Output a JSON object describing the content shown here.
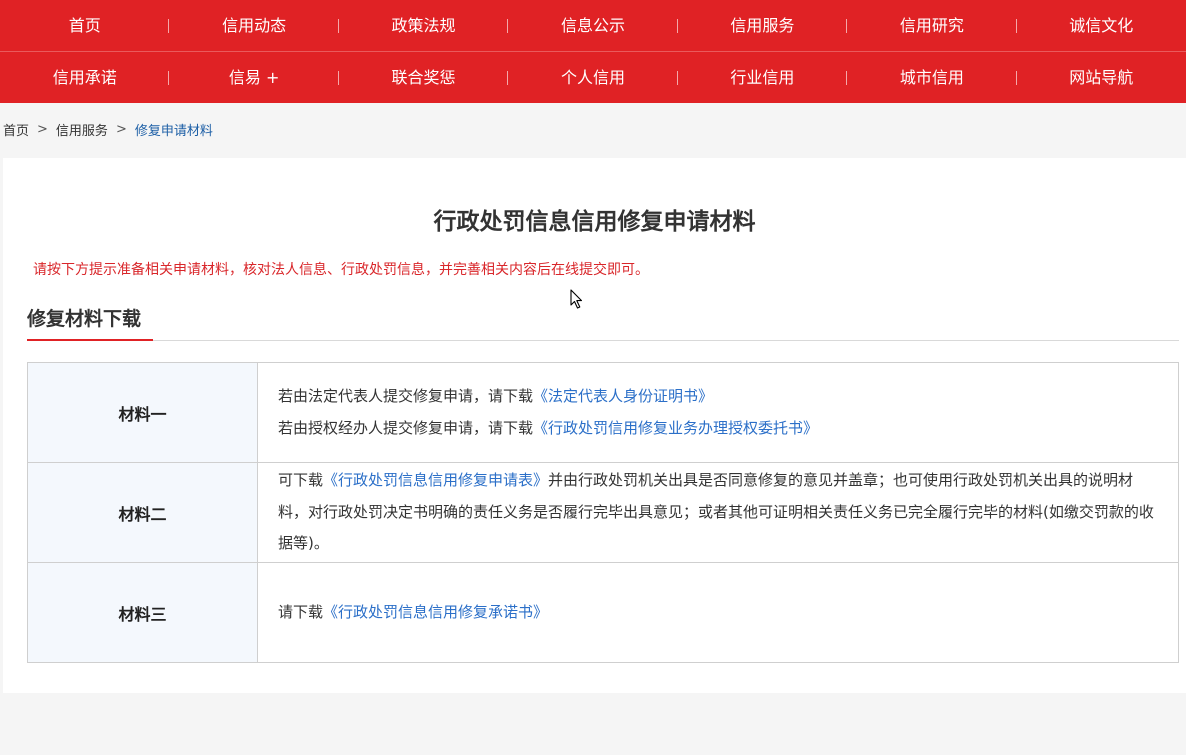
{
  "nav": {
    "row1": [
      "首页",
      "信用动态",
      "政策法规",
      "信息公示",
      "信用服务",
      "信用研究",
      "诚信文化"
    ],
    "row2": [
      "信用承诺",
      "信易 +",
      "联合奖惩",
      "个人信用",
      "行业信用",
      "城市信用",
      "网站导航"
    ]
  },
  "breadcrumb": {
    "home": "首页",
    "sep": ">",
    "level1": "信用服务",
    "current": "修复申请材料"
  },
  "page": {
    "title": "行政处罚信息信用修复申请材料",
    "notice": "请按下方提示准备相关申请材料，核对法人信息、行政处罚信息，并完善相关内容后在线提交即可。",
    "section_title": "修复材料下载"
  },
  "materials": [
    {
      "label": "材料一",
      "lines": [
        {
          "text": "若由法定代表人提交修复申请，请下载",
          "link": "《法定代表人身份证明书》"
        },
        {
          "text": "若由授权经办人提交修复申请，请下载",
          "link": "《行政处罚信用修复业务办理授权委托书》"
        }
      ]
    },
    {
      "label": "材料二",
      "pre": "可下载",
      "link": "《行政处罚信息信用修复申请表》",
      "post": "并由行政处罚机关出具是否同意修复的意见并盖章；也可使用行政处罚机关出具的说明材料，对行政处罚决定书明确的责任义务是否履行完毕出具意见；或者其他可证明相关责任义务已完全履行完毕的材料(如缴交罚款的收据等)。"
    },
    {
      "label": "材料三",
      "pre": "请下载",
      "link": "《行政处罚信息信用修复承诺书》"
    }
  ],
  "colors": {
    "nav_bg": "#e02225",
    "notice": "#d9262a",
    "link": "#2b6fc8",
    "label_bg": "#f4f8fd"
  }
}
